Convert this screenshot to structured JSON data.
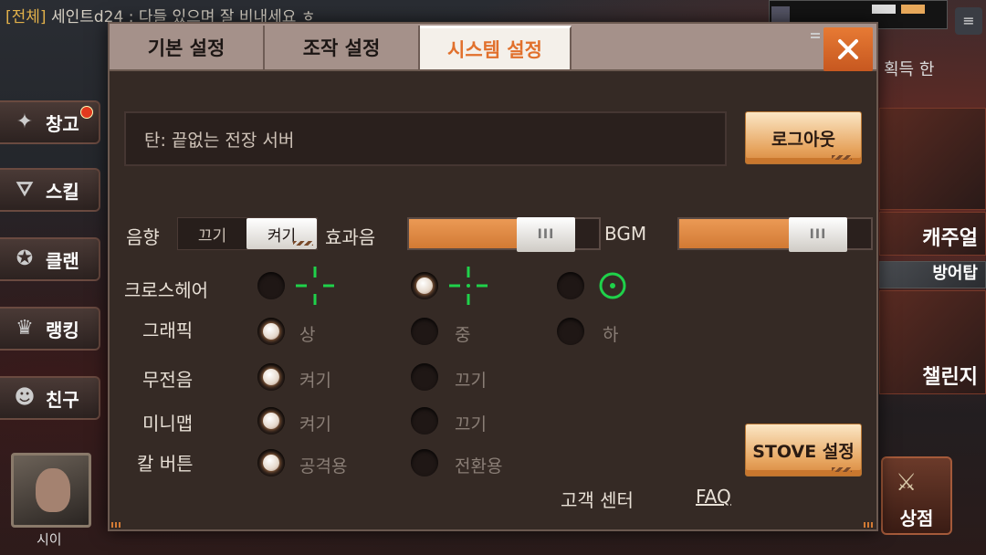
{
  "background": {
    "chat_tag": "[전체]",
    "chat_text": " 세인트d24 : 다들 있으며 잘 비내세요 ㅎ",
    "side_menu": [
      {
        "label": "창고",
        "icon": "warehouse-icon",
        "badge": true
      },
      {
        "label": "스킬",
        "icon": "skill-icon",
        "badge": false
      },
      {
        "label": "클랜",
        "icon": "clan-icon",
        "badge": false
      },
      {
        "label": "랭킹",
        "icon": "ranking-icon",
        "badge": false
      },
      {
        "label": "친구",
        "icon": "friend-icon",
        "badge": false
      }
    ],
    "user_name": "시이",
    "right_label": "획득 한",
    "right_cards": [
      "캐주얼",
      "방어탑",
      "챌린지"
    ],
    "shop_label": "상점"
  },
  "modal": {
    "tabs": [
      "기본 설정",
      "조작 설정",
      "시스템 설정"
    ],
    "active_tab": 2,
    "close_icon": "close-icon",
    "server_name": "탄: 끝없는 전장 서버",
    "logout_label": "로그아웃",
    "sound": {
      "label": "음향",
      "off_label": "끄기",
      "on_label": "켜기",
      "selected": "on",
      "sfx_label": "효과음",
      "sfx_level": 0.82,
      "bgm_label": "BGM",
      "bgm_level": 0.82,
      "knob_text": "III"
    },
    "crosshair": {
      "label": "크로스헤어",
      "options": [
        "cross-gap-icon",
        "cross-dot-icon",
        "circle-dot-icon"
      ],
      "selected": 1
    },
    "graphics": {
      "label": "그래픽",
      "options": [
        "상",
        "중",
        "하"
      ],
      "selected": 0
    },
    "voice": {
      "label": "무전음",
      "options": [
        "켜기",
        "끄기"
      ],
      "selected": 0
    },
    "minimap": {
      "label": "미니맵",
      "options": [
        "켜기",
        "끄기"
      ],
      "selected": 0
    },
    "knife": {
      "label": "칼 버튼",
      "options": [
        "공격용",
        "전환용"
      ],
      "selected": 0
    },
    "stove_label": "STOVE 설정",
    "support_label": "고객 센터",
    "faq_label": "FAQ",
    "colors": {
      "accent": "#e1702c",
      "crosshair_green": "#1fd14a"
    }
  }
}
